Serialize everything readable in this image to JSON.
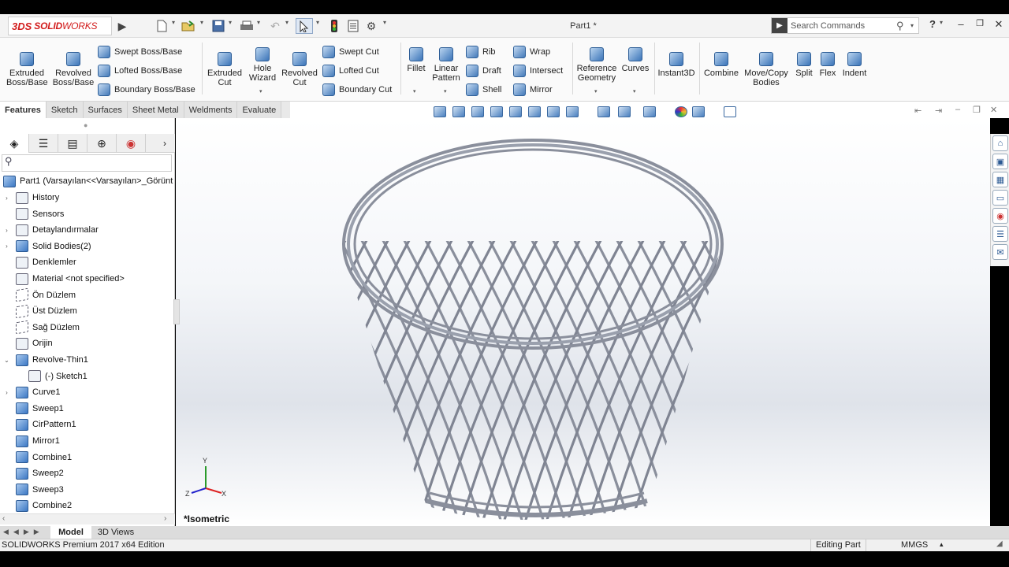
{
  "app": {
    "logo_ds": "3DS",
    "logo_solid": "SOLID",
    "logo_works": "WORKS",
    "title": "Part1 *"
  },
  "search": {
    "placeholder": "Search Commands"
  },
  "help": "?",
  "ribbon": {
    "extruded_boss": [
      "Extruded",
      "Boss/Base"
    ],
    "revolved_boss": [
      "Revolved",
      "Boss/Base"
    ],
    "swept_boss": "Swept Boss/Base",
    "lofted_boss": "Lofted Boss/Base",
    "boundary_boss": "Boundary Boss/Base",
    "extruded_cut": [
      "Extruded",
      "Cut"
    ],
    "hole_wizard": [
      "Hole",
      "Wizard"
    ],
    "revolved_cut": [
      "Revolved",
      "Cut"
    ],
    "swept_cut": "Swept Cut",
    "lofted_cut": "Lofted Cut",
    "boundary_cut": "Boundary Cut",
    "fillet": "Fillet",
    "linear_pattern": [
      "Linear",
      "Pattern"
    ],
    "rib": "Rib",
    "draft": "Draft",
    "shell": "Shell",
    "wrap": "Wrap",
    "intersect": "Intersect",
    "mirror": "Mirror",
    "reference_geometry": [
      "Reference",
      "Geometry"
    ],
    "curves": "Curves",
    "instant3d": "Instant3D",
    "combine": "Combine",
    "move_copy": [
      "Move/Copy",
      "Bodies"
    ],
    "split": "Split",
    "flex": "Flex",
    "indent": "Indent"
  },
  "tabs": [
    "Features",
    "Sketch",
    "Surfaces",
    "Sheet Metal",
    "Weldments",
    "Evaluate"
  ],
  "tree": {
    "root": "Part1  (Varsayılan<<Varsayılan>_Görünt",
    "items": [
      {
        "label": "History",
        "expand": "›",
        "icon": "history-icon"
      },
      {
        "label": "Sensors",
        "expand": "",
        "icon": "sensors-icon"
      },
      {
        "label": "Detaylandırmalar",
        "expand": "›",
        "icon": "annotations-icon"
      },
      {
        "label": "Solid Bodies(2)",
        "expand": "›",
        "icon": "solid-bodies-icon"
      },
      {
        "label": "Denklemler",
        "expand": "",
        "icon": "equations-icon"
      },
      {
        "label": "Material <not specified>",
        "expand": "",
        "icon": "material-icon"
      },
      {
        "label": "Ön Düzlem",
        "expand": "",
        "icon": "plane-icon"
      },
      {
        "label": "Üst Düzlem",
        "expand": "",
        "icon": "plane-icon"
      },
      {
        "label": "Sağ Düzlem",
        "expand": "",
        "icon": "plane-icon"
      },
      {
        "label": "Orijin",
        "expand": "",
        "icon": "origin-icon"
      },
      {
        "label": "Revolve-Thin1",
        "expand": "⌄",
        "icon": "revolve-icon"
      },
      {
        "label": "(-) Sketch1",
        "expand": "",
        "icon": "sketch-icon",
        "indent": true
      },
      {
        "label": "Curve1",
        "expand": "›",
        "icon": "curve-icon"
      },
      {
        "label": "Sweep1",
        "expand": "",
        "icon": "sweep-icon"
      },
      {
        "label": "CirPattern1",
        "expand": "",
        "icon": "circular-pattern-icon"
      },
      {
        "label": "Mirror1",
        "expand": "",
        "icon": "mirror-icon"
      },
      {
        "label": "Combine1",
        "expand": "",
        "icon": "combine-icon"
      },
      {
        "label": "Sweep2",
        "expand": "",
        "icon": "sweep-icon"
      },
      {
        "label": "Sweep3",
        "expand": "",
        "icon": "sweep-icon"
      },
      {
        "label": "Combine2",
        "expand": "",
        "icon": "combine-icon"
      }
    ]
  },
  "bottom_tabs": [
    "Model",
    "3D Views"
  ],
  "view": {
    "orientation": "*Isometric",
    "axis_x": "X",
    "axis_y": "Y",
    "axis_z": "Z"
  },
  "status": {
    "edition": "SOLIDWORKS Premium 2017 x64 Edition",
    "mode": "Editing Part",
    "units": "MMGS"
  },
  "colors": {
    "model": "#8a8f9c",
    "accent": "#d21c1c",
    "icon_blue": "#3b74b8"
  }
}
